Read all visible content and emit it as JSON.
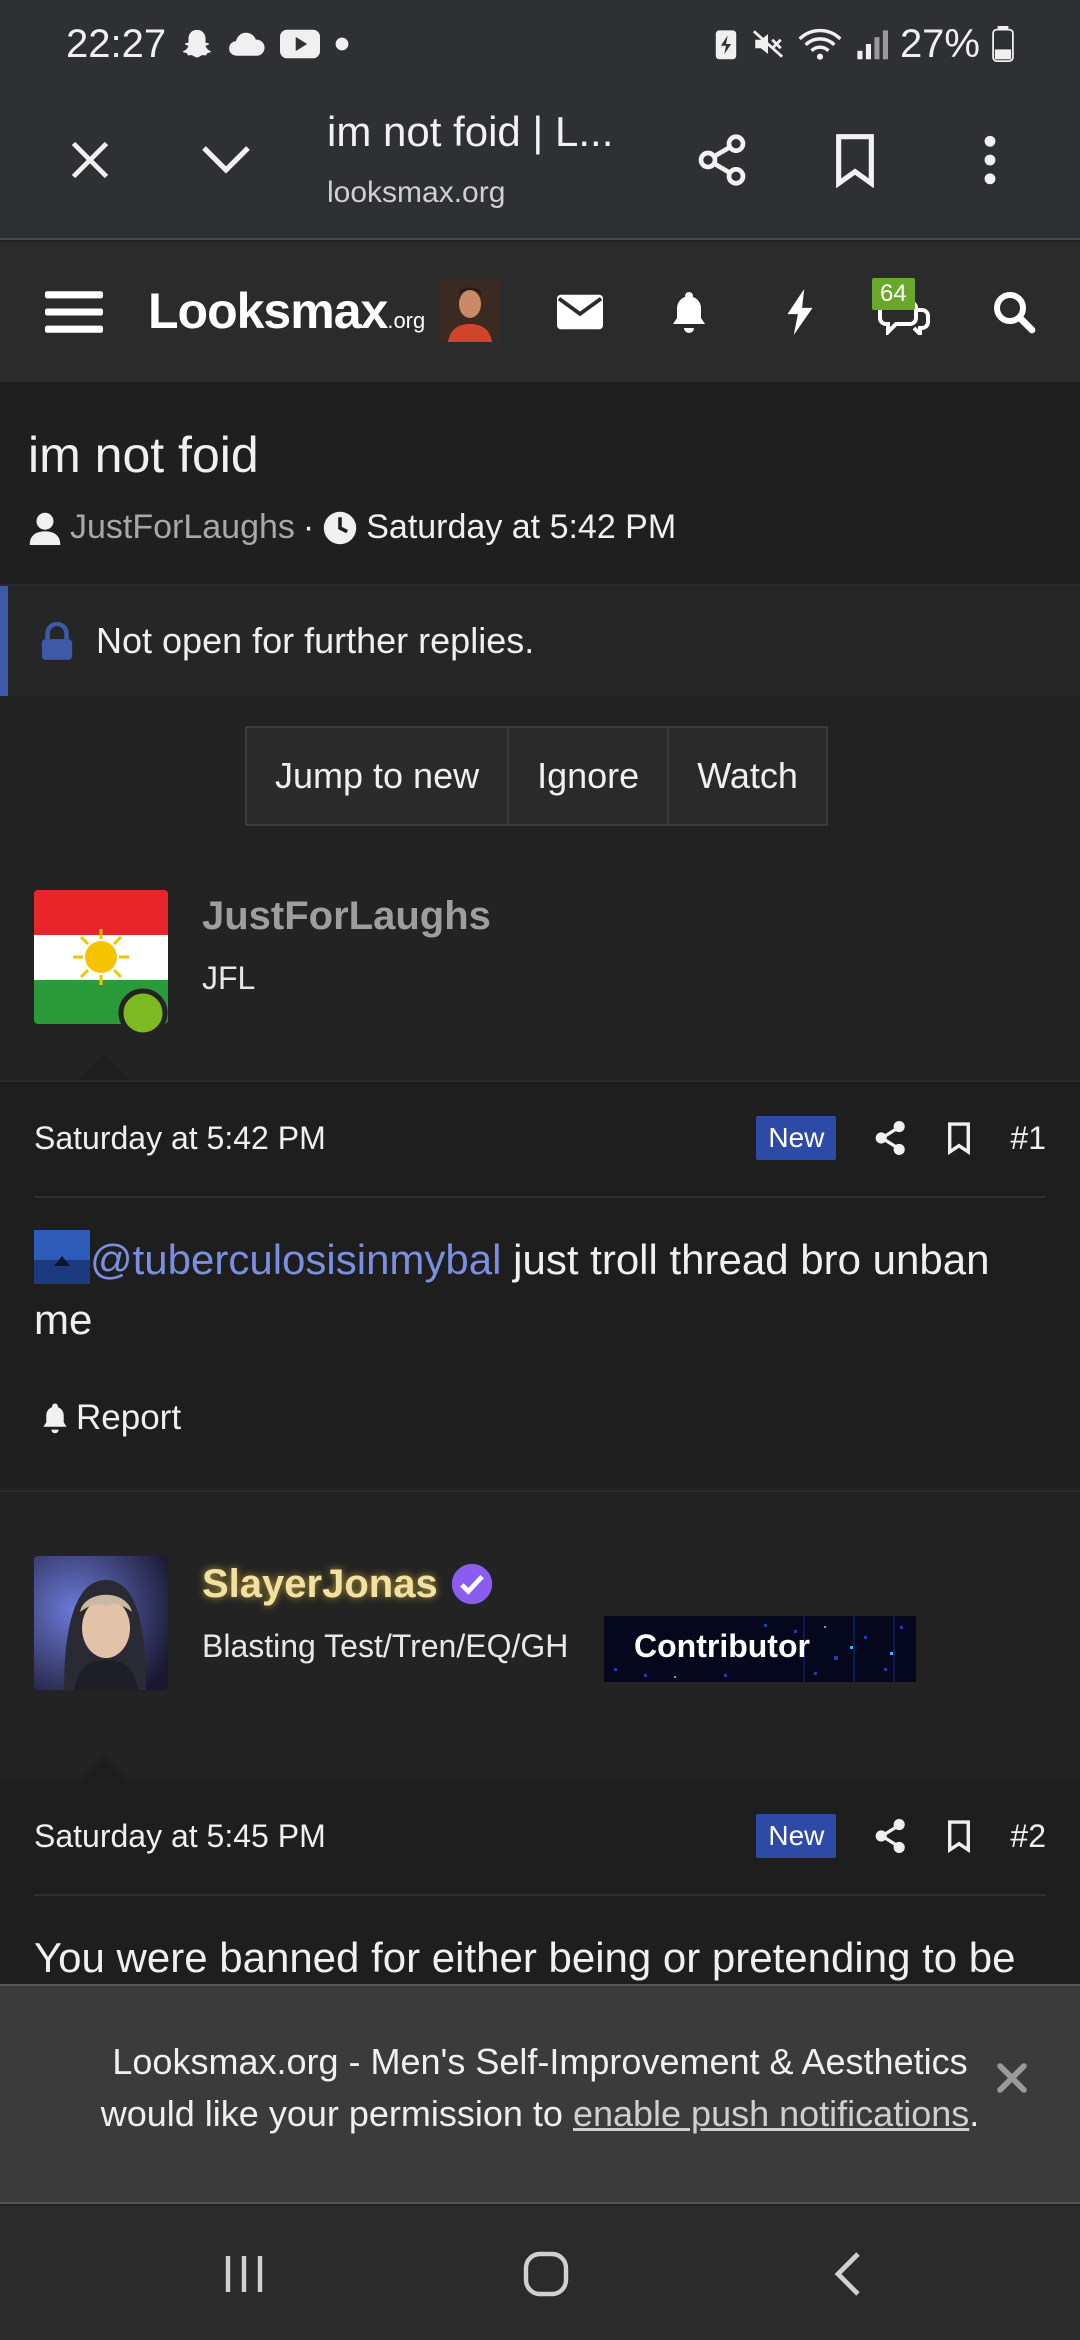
{
  "status_bar": {
    "time": "22:27",
    "battery": "27%"
  },
  "browser": {
    "tab_title": "im not foid | L...",
    "url": "looksmax.org"
  },
  "site": {
    "logo_text": "Looksmax",
    "logo_suffix": ".org",
    "badge_count": "64"
  },
  "thread": {
    "title": "im not foid",
    "author": "JustForLaughs",
    "separator": "·",
    "date": "Saturday at 5:42 PM",
    "locked_notice": "Not open for further replies.",
    "buttons": [
      "Jump to new",
      "Ignore",
      "Watch"
    ]
  },
  "posts": [
    {
      "username": "JustForLaughs",
      "user_title": "JFL",
      "date": "Saturday at 5:42 PM",
      "badge": "New",
      "number": "#1",
      "mention": "@tuberculosisinmybal",
      "text_line1": "just troll thread bro unban",
      "text_line2": "me",
      "report": "Report"
    },
    {
      "username": "SlayerJonas",
      "user_title": "Blasting Test/Tren/EQ/GH",
      "banner": "Contributor",
      "date": "Saturday at 5:45 PM",
      "badge": "New",
      "number": "#2",
      "text_line1": "You were banned for either being or pretending to be"
    }
  ],
  "push_banner": {
    "text_line1": "Looksmax.org - Men's Self-Improvement & Aesthetics",
    "text_line2_prefix": "would like your permission to",
    "link": "enable push notifications",
    "text_line2_suffix": "."
  },
  "colors": {
    "accent_blue": "#2d4aa6",
    "mention": "#7a8fe0",
    "online_green": "#7dba22",
    "badge_green": "#6aa82c",
    "verified_purple": "#8a5cf0"
  }
}
